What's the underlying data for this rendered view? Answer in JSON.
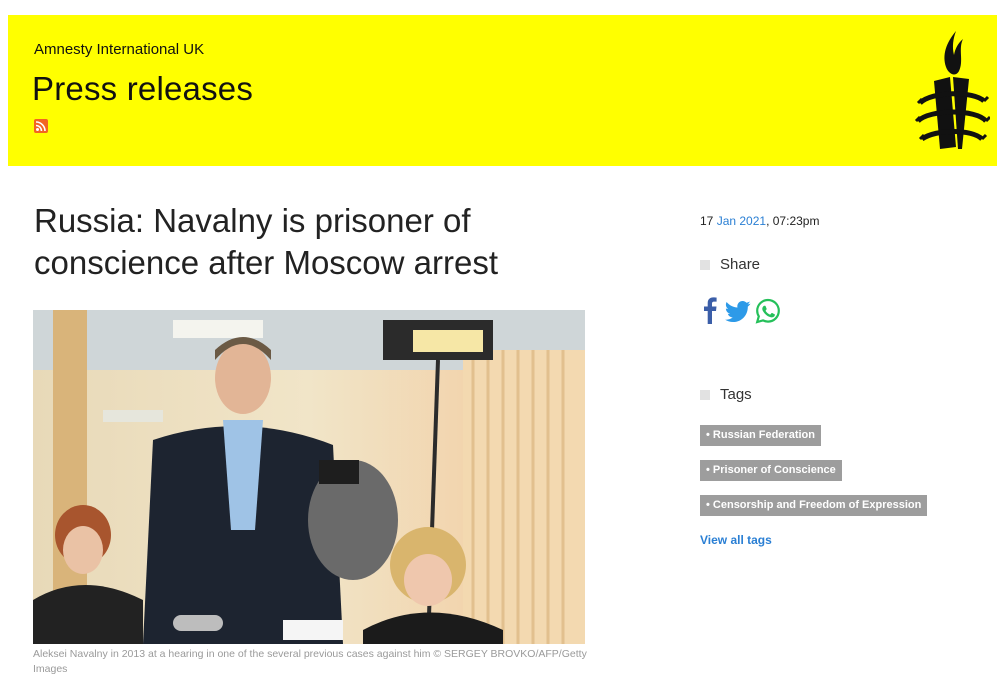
{
  "header": {
    "org_name": "Amnesty International UK",
    "section_title": "Press releases",
    "background_color": "#ffff00",
    "rss_icon": "rss-icon",
    "logo_icon": "amnesty-candle-logo-icon"
  },
  "article": {
    "title": "Russia: Navalny is prisoner of conscience after Moscow arrest",
    "caption": "Aleksei Navalny in 2013 at a hearing in one of the several previous cases against him © SERGEY BROVKO/AFP/Getty Images"
  },
  "sidebar": {
    "date": {
      "day": "17",
      "month_year": "Jan 2021",
      "time": ", 07:23pm",
      "link_color": "#2a7fd4"
    },
    "share": {
      "heading": "Share",
      "icons": [
        "facebook-icon",
        "twitter-icon",
        "whatsapp-icon"
      ]
    },
    "tags": {
      "heading": "Tags",
      "items": [
        "• Russian Federation",
        "• Prisoner of Conscience",
        "• Censorship and Freedom of Expression"
      ],
      "view_all": "View all tags"
    }
  }
}
